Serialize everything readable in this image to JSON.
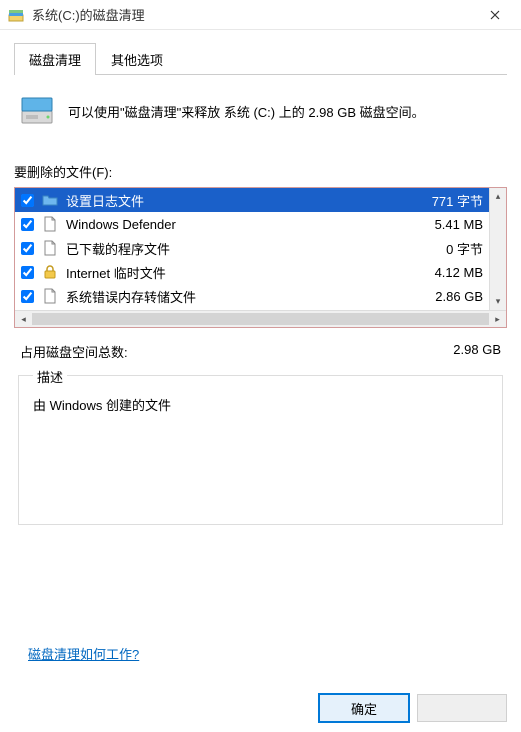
{
  "window": {
    "title": "系统(C:)的磁盘清理"
  },
  "tabs": {
    "cleanup": "磁盘清理",
    "other": "其他选项"
  },
  "summary": "可以使用\"磁盘清理\"来释放 系统 (C:) 上的 2.98 GB 磁盘空间。",
  "files_label": "要删除的文件(F):",
  "rows": [
    {
      "name": "设置日志文件",
      "size": "771 字节",
      "selected": true,
      "icon": "folder-blue"
    },
    {
      "name": "Windows Defender",
      "size": "5.41 MB",
      "selected": false,
      "icon": "file"
    },
    {
      "name": "已下载的程序文件",
      "size": "0 字节",
      "selected": false,
      "icon": "file"
    },
    {
      "name": "Internet 临时文件",
      "size": "4.12 MB",
      "selected": false,
      "icon": "lock"
    },
    {
      "name": "系统错误内存转储文件",
      "size": "2.86 GB",
      "selected": false,
      "icon": "file"
    }
  ],
  "total": {
    "label": "占用磁盘空间总数:",
    "value": "2.98 GB"
  },
  "description": {
    "legend": "描述",
    "text": "由 Windows 创建的文件"
  },
  "link": "磁盘清理如何工作?",
  "buttons": {
    "ok": "确定",
    "cancel": " "
  }
}
